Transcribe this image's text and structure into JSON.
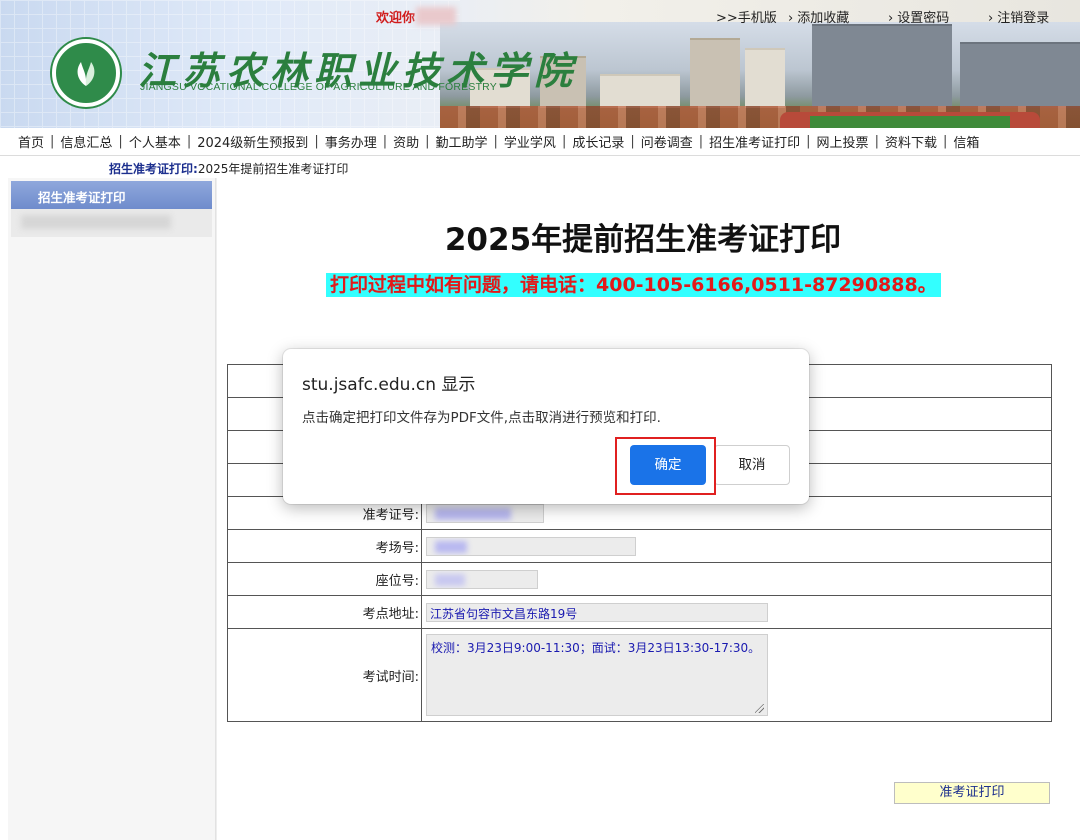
{
  "banner": {
    "welcome": "欢迎你",
    "school_name_cn": "江苏农林职业技术学院",
    "school_name_en": "JIANGSU VOCATIONAL COLLEGE OF AGRICULTURE AND FORESTRY",
    "links": [
      ">>手机版",
      "添加收藏",
      "设置密码",
      "注销登录"
    ],
    "brand_color": "#2b7f3e"
  },
  "nav": {
    "items": [
      "首页",
      "信息汇总",
      "个人基本",
      "2024级新生预报到",
      "事务办理",
      "资助",
      "勤工助学",
      "学业学风",
      "成长记录",
      "问卷调查",
      "招生准考证打印",
      "网上投票",
      "资料下载",
      "信箱"
    ]
  },
  "breadcrumb": {
    "title": "招生准考证打印:",
    "current": "2025年提前招生准考证打印"
  },
  "sidebar": {
    "active_item": "招生准考证打印"
  },
  "main": {
    "page_title": "2025年提前招生准考证打印",
    "hotline": "打印过程中如有问题，请电话：400-105-6166,0511-87290888。",
    "hotline_bg": "#33ffff",
    "hotline_color": "#e21a1a",
    "fields": {
      "ticket_no_label": "准考证号:",
      "exam_room_label": "考场号:",
      "seat_no_label": "座位号:",
      "address_label": "考点地址:",
      "address_value": "江苏省句容市文昌东路19号",
      "time_label": "考试时间:",
      "time_value": "校测：3月23日9:00-11:30；面试：3月23日13:30-17:30。"
    },
    "print_button": "准考证打印"
  },
  "dialog": {
    "title": "stu.jsafc.edu.cn 显示",
    "message": "点击确定把打印文件存为PDF文件,点击取消进行预览和打印.",
    "ok_label": "确定",
    "cancel_label": "取消",
    "ok_color": "#1a73e8"
  }
}
